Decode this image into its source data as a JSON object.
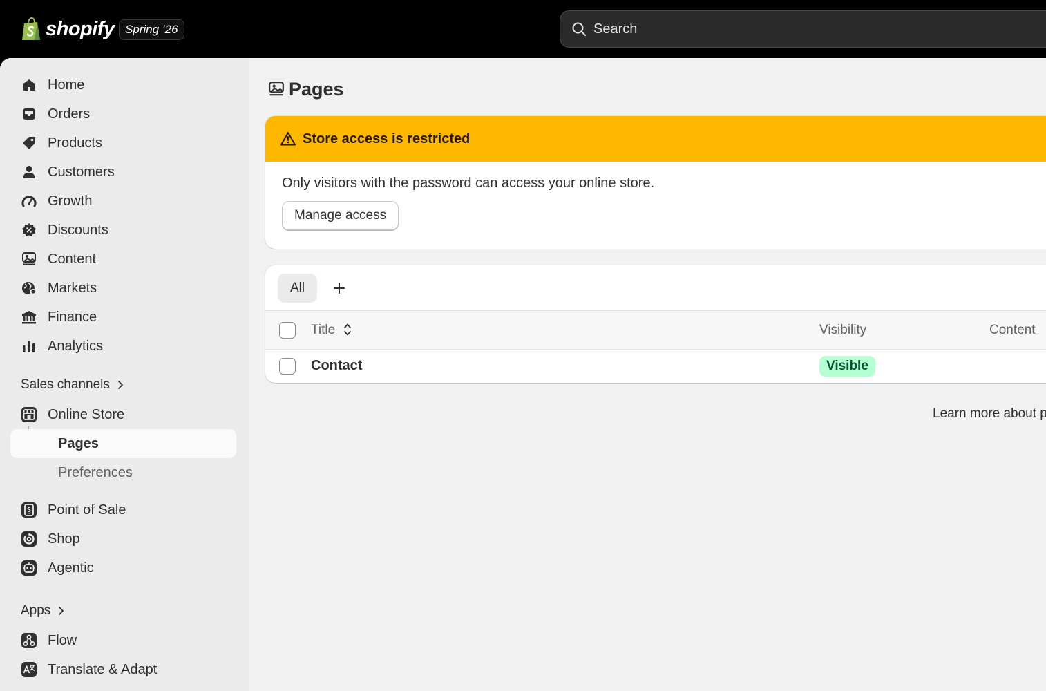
{
  "topbar": {
    "brand": "shopify",
    "edition": "Spring ’26",
    "search_placeholder": "Search"
  },
  "sidebar": {
    "items": [
      {
        "label": "Home",
        "icon": "home-icon"
      },
      {
        "label": "Orders",
        "icon": "inbox-icon"
      },
      {
        "label": "Products",
        "icon": "tag-icon"
      },
      {
        "label": "Customers",
        "icon": "person-icon"
      },
      {
        "label": "Growth",
        "icon": "gauge-icon"
      },
      {
        "label": "Discounts",
        "icon": "discount-icon"
      },
      {
        "label": "Content",
        "icon": "content-icon"
      },
      {
        "label": "Markets",
        "icon": "globe-icon"
      },
      {
        "label": "Finance",
        "icon": "bank-icon"
      },
      {
        "label": "Analytics",
        "icon": "bar-chart-icon"
      }
    ],
    "sales_channels_label": "Sales channels",
    "online_store_label": "Online Store",
    "online_store_sub": [
      {
        "label": "Pages",
        "active": true
      },
      {
        "label": "Preferences",
        "active": false
      }
    ],
    "channels": [
      {
        "label": "Point of Sale",
        "icon": "pos-icon"
      },
      {
        "label": "Shop",
        "icon": "shop-icon"
      },
      {
        "label": "Agentic",
        "icon": "agentic-icon"
      }
    ],
    "apps_label": "Apps",
    "apps": [
      {
        "label": "Flow",
        "icon": "flow-icon"
      },
      {
        "label": "Translate & Adapt",
        "icon": "translate-icon"
      }
    ]
  },
  "main": {
    "page_title": "Pages",
    "banner": {
      "title": "Store access is restricted",
      "body": "Only visitors with the password can access your online store.",
      "button": "Manage access"
    },
    "tabs": [
      {
        "label": "All"
      }
    ],
    "table": {
      "columns": [
        "Title",
        "Visibility",
        "Content"
      ],
      "rows": [
        {
          "title": "Contact",
          "visibility": "Visible"
        }
      ]
    },
    "learn_more": "Learn more about p"
  },
  "colors": {
    "topbar": "#000000",
    "banner_warning": "#ffb800",
    "badge_success_bg": "#b4fed2",
    "badge_success_text": "#0c5132"
  }
}
